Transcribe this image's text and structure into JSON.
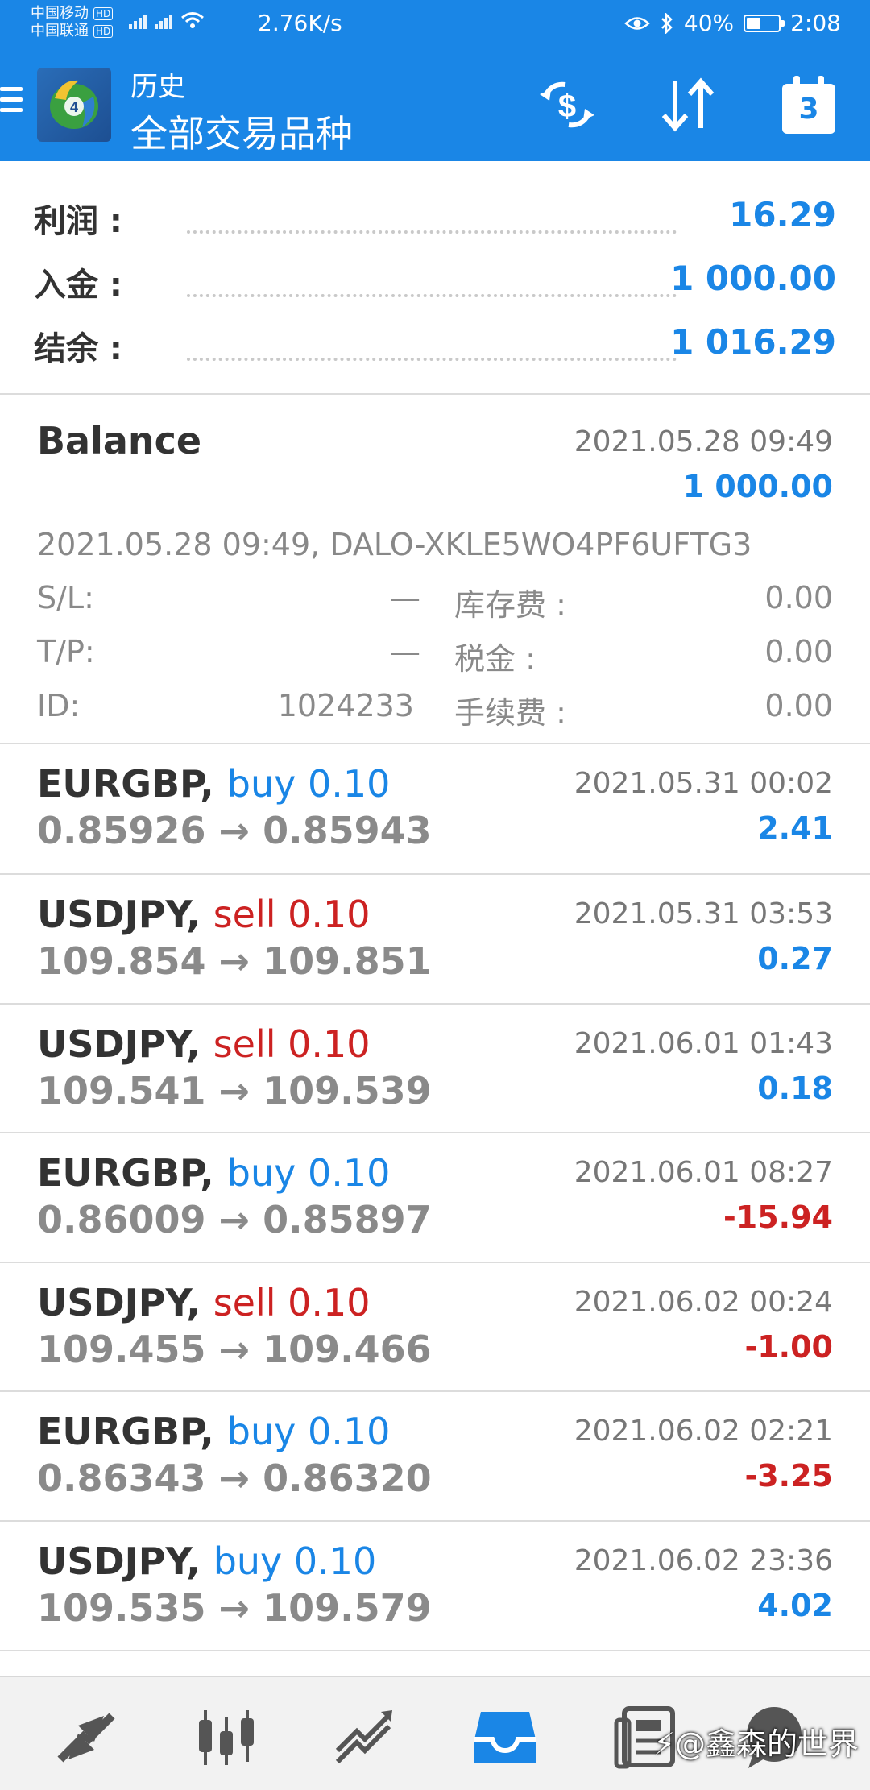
{
  "status_bar": {
    "carrier1": "中国移动",
    "carrier2": "中国联通",
    "hd": "HD",
    "net_speed": "2.76K/s",
    "battery": "40%",
    "time": "2:08"
  },
  "header": {
    "title_small": "历史",
    "title_large": "全部交易品种",
    "calendar_label": "3",
    "bg_color": "#1a86e6"
  },
  "summary": {
    "rows": [
      {
        "label": "利润 :",
        "value": "16.29"
      },
      {
        "label": "入金 :",
        "value": "1 000.00"
      },
      {
        "label": "结余 :",
        "value": "1 016.29"
      }
    ]
  },
  "balance": {
    "title": "Balance",
    "time": "2021.05.28 09:49",
    "amount": "1 000.00",
    "comment": "2021.05.28 09:49, DALO-XKLE5WO4PF6UFTG3",
    "sl_label": "S/L:",
    "sl_value": "—",
    "tp_label": "T/P:",
    "tp_value": "—",
    "id_label": "ID:",
    "id_value": "1024233",
    "swap_label": "库存费 :",
    "swap_value": "0.00",
    "tax_label": "税金 :",
    "tax_value": "0.00",
    "fee_label": "手续费 :",
    "fee_value": "0.00"
  },
  "trades": [
    {
      "symbol": "EURGBP,",
      "direction": "buy 0.10",
      "type": "buy",
      "prices": "0.85926 → 0.85943",
      "time": "2021.05.31 00:02",
      "profit": "2.41",
      "sign": "pos"
    },
    {
      "symbol": "USDJPY,",
      "direction": "sell 0.10",
      "type": "sell",
      "prices": "109.854 → 109.851",
      "time": "2021.05.31 03:53",
      "profit": "0.27",
      "sign": "pos"
    },
    {
      "symbol": "USDJPY,",
      "direction": "sell 0.10",
      "type": "sell",
      "prices": "109.541 → 109.539",
      "time": "2021.06.01 01:43",
      "profit": "0.18",
      "sign": "pos"
    },
    {
      "symbol": "EURGBP,",
      "direction": "buy 0.10",
      "type": "buy",
      "prices": "0.86009 → 0.85897",
      "time": "2021.06.01 08:27",
      "profit": "-15.94",
      "sign": "neg"
    },
    {
      "symbol": "USDJPY,",
      "direction": "sell 0.10",
      "type": "sell",
      "prices": "109.455 → 109.466",
      "time": "2021.06.02 00:24",
      "profit": "-1.00",
      "sign": "neg"
    },
    {
      "symbol": "EURGBP,",
      "direction": "buy 0.10",
      "type": "buy",
      "prices": "0.86343 → 0.86320",
      "time": "2021.06.02 02:21",
      "profit": "-3.25",
      "sign": "neg"
    },
    {
      "symbol": "USDJPY,",
      "direction": "buy 0.10",
      "type": "buy",
      "prices": "109.535 → 109.579",
      "time": "2021.06.02 23:36",
      "profit": "4.02",
      "sign": "pos"
    }
  ],
  "bottom_nav": {
    "items": [
      "quotes-icon",
      "chart-icon",
      "trade-icon",
      "history-icon",
      "news-icon",
      "chat-icon"
    ],
    "watermark": "@鑫森的世界"
  }
}
